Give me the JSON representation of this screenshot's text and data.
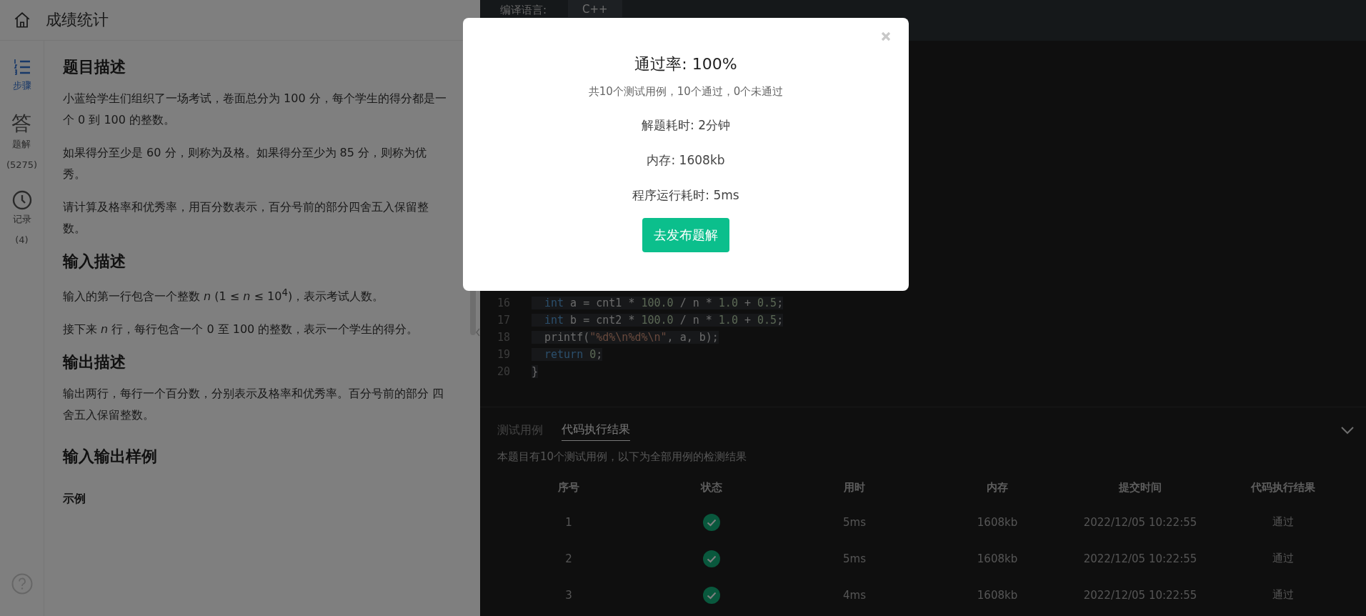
{
  "header": {
    "title": "成绩统计"
  },
  "sidebar": {
    "items": [
      {
        "label": "步骤",
        "selected": true
      },
      {
        "label": "题解",
        "glyph": "答",
        "count": "(5275)",
        "selected": false
      },
      {
        "label": "记录",
        "count": "(4)",
        "selected": false
      }
    ]
  },
  "problem": {
    "sections": [
      {
        "heading": "题目描述",
        "paragraphs": [
          "小蓝给学生们组织了一场考试，卷面总分为 100 分，每个学生的得分都是一个 0 到 100 的整数。",
          "如果得分至少是 60 分，则称为及格。如果得分至少为 85 分，则称为优秀。",
          "请计算及格率和优秀率，用百分数表示，百分号前的部分四舍五入保留整数。"
        ]
      },
      {
        "heading": "输入描述",
        "paragraphs": [
          "输入的第一行包含一个整数 *n* (1 ≤ *n* ≤ 10$^{4}$)，表示考试人数。",
          "接下来 *n* 行，每行包含一个 0 至 100 的整数，表示一个学生的得分。"
        ]
      },
      {
        "heading": "输出描述",
        "paragraphs": [
          "输出两行，每行一个百分数，分别表示及格率和优秀率。百分号前的部分 四舍五入保留整数。"
        ]
      },
      {
        "heading": "输入输出样例",
        "subheading": "示例"
      }
    ]
  },
  "editor": {
    "language_label": "编译语言:",
    "language": "C++",
    "lines": [
      {
        "number": "16",
        "indented": true,
        "tokens": [
          {
            "kind": "keyword",
            "text": "int"
          },
          {
            "kind": "plain",
            "text": " a = cnt1 * "
          },
          {
            "kind": "number",
            "text": "100.0"
          },
          {
            "kind": "plain",
            "text": " / n * "
          },
          {
            "kind": "number",
            "text": "1.0"
          },
          {
            "kind": "plain",
            "text": " + "
          },
          {
            "kind": "number",
            "text": "0.5"
          },
          {
            "kind": "plain",
            "text": ";"
          }
        ]
      },
      {
        "number": "17",
        "indented": true,
        "tokens": [
          {
            "kind": "keyword",
            "text": "int"
          },
          {
            "kind": "plain",
            "text": " b = cnt2 * "
          },
          {
            "kind": "number",
            "text": "100.0"
          },
          {
            "kind": "plain",
            "text": " / n * "
          },
          {
            "kind": "number",
            "text": "1.0"
          },
          {
            "kind": "plain",
            "text": " + "
          },
          {
            "kind": "number",
            "text": "0.5"
          },
          {
            "kind": "plain",
            "text": ";"
          }
        ]
      },
      {
        "number": "18",
        "indented": true,
        "tokens": [
          {
            "kind": "plain",
            "text": "printf("
          },
          {
            "kind": "string",
            "text": "\"%d%\\n%d%\\n\""
          },
          {
            "kind": "plain",
            "text": ", a, b);"
          }
        ]
      },
      {
        "number": "19",
        "indented": true,
        "tokens": [
          {
            "kind": "keyword",
            "text": "return"
          },
          {
            "kind": "number",
            "text": " 0"
          },
          {
            "kind": "plain",
            "text": ";"
          }
        ]
      },
      {
        "number": "20",
        "indented": false,
        "tokens": [
          {
            "kind": "plain",
            "text": "}"
          }
        ]
      }
    ]
  },
  "results": {
    "tabs": [
      {
        "label": "测试用例",
        "selected": false
      },
      {
        "label": "代码执行结果",
        "selected": true
      }
    ],
    "summary": "本题目有10个测试用例，以下为全部用例的检测结果",
    "columns": [
      "序号",
      "状态",
      "用时",
      "内存",
      "提交时间",
      "代码执行结果"
    ],
    "rows": [
      {
        "index": "1",
        "passed": true,
        "time": "5ms",
        "memory": "1608kb",
        "submitted": "2022/12/05 10:22:55",
        "result": "通过"
      },
      {
        "index": "2",
        "passed": true,
        "time": "5ms",
        "memory": "1608kb",
        "submitted": "2022/12/05 10:22:55",
        "result": "通过"
      },
      {
        "index": "3",
        "passed": true,
        "time": "4ms",
        "memory": "1608kb",
        "submitted": "2022/12/05 10:22:55",
        "result": "通过"
      }
    ]
  },
  "dialog": {
    "title": "通过率: 100%",
    "subtitle": "共10个测试用例，10个通过，0个未通过",
    "lines": [
      "解题耗时: 2分钟",
      "内存: 1608kb",
      "程序运行耗时: 5ms"
    ],
    "button": "去发布题解"
  }
}
